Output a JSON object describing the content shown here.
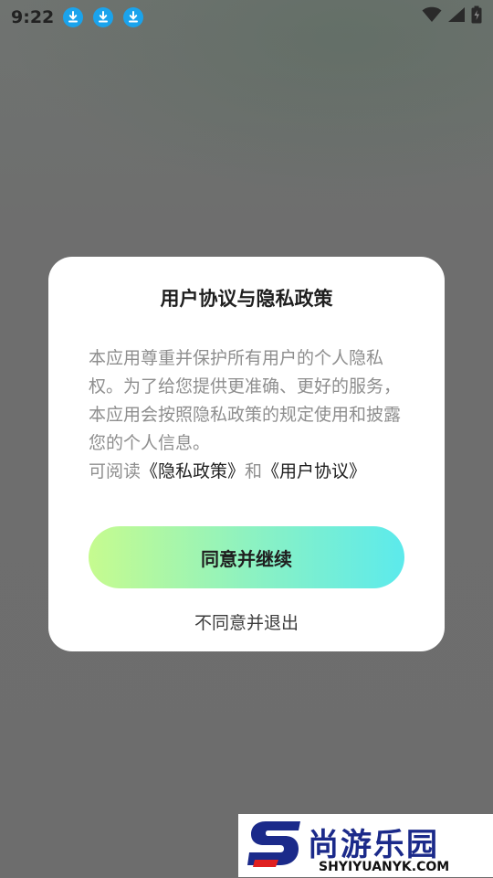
{
  "status_bar": {
    "time": "9:22",
    "notification_icons": [
      "download-icon",
      "download-icon",
      "download-icon"
    ],
    "status_icons": [
      "wifi-icon",
      "signal-icon",
      "battery-charging-icon"
    ],
    "accent_color": "#1aa3ec"
  },
  "dialog": {
    "title": "用户协议与隐私政策",
    "body_text": "本应用尊重并保护所有用户的个人隐私权。为了给您提供更准确、更好的服务，本应用会按照隐私政策的规定使用和披露您的个人信息。",
    "read_prefix": "可阅读",
    "privacy_link": "《隐私政策》",
    "and_text": "和",
    "agreement_link": "《用户协议》",
    "agree_button": "同意并继续",
    "reject_button": "不同意并退出",
    "button_gradient": [
      "#c6fb8f",
      "#5ceaec"
    ]
  },
  "watermark": {
    "brand_cn": "尚游乐园",
    "brand_en": "SHYIYUANYK.COM",
    "brand_color": "#1b2a8a"
  }
}
